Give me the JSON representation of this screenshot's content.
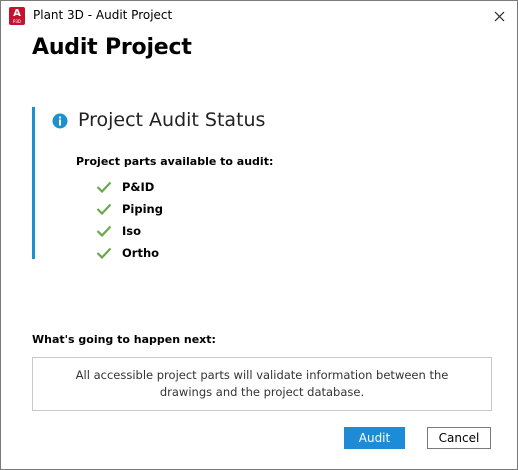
{
  "window": {
    "title": "Plant 3D - Audit Project",
    "app_icon_letter": "A",
    "app_icon_sub": "P3D"
  },
  "dialog": {
    "heading": "Audit Project"
  },
  "status": {
    "title": "Project Audit Status",
    "parts_label": "Project parts available to audit:",
    "parts": [
      {
        "label": "P&ID"
      },
      {
        "label": "Piping"
      },
      {
        "label": "Iso"
      },
      {
        "label": "Ortho"
      }
    ]
  },
  "next": {
    "label": "What's going to happen next:",
    "description": "All accessible project parts will validate information between the drawings and the project database."
  },
  "buttons": {
    "audit": "Audit",
    "cancel": "Cancel"
  },
  "colors": {
    "accent": "#1d91d0",
    "primary_button": "#1f8ad6",
    "check": "#6aa84f",
    "app_icon": "#c4132f"
  }
}
